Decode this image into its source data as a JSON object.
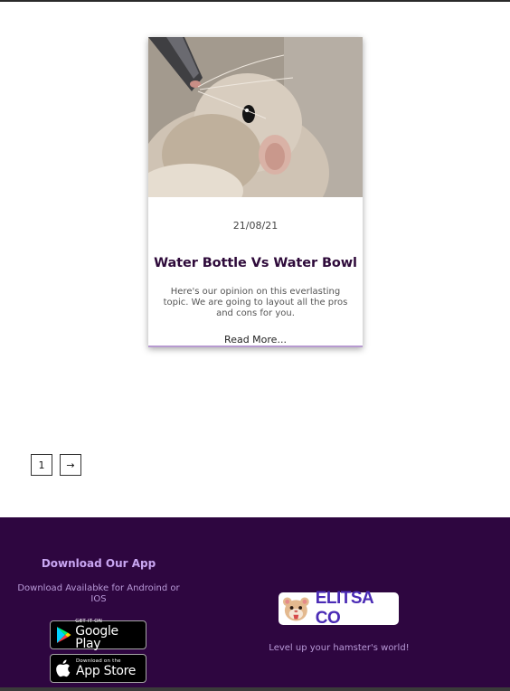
{
  "post": {
    "date": "21/08/21",
    "title": "Water Bottle Vs Water Bowl",
    "excerpt": "Here's our opinion on this everlasting topic. We are going to layout all the pros and cons for you.",
    "read_more": "Read More..."
  },
  "pagination": {
    "current": "1",
    "next": "→"
  },
  "footer": {
    "app_title": "Download Our App",
    "app_text": "Download Availabke for Androind or IOS",
    "google_play": {
      "small": "GET IT ON",
      "big": "Google Play"
    },
    "app_store": {
      "small": "Download on the",
      "big": "App Store"
    },
    "brand_name": "ELITSA CO",
    "tagline": "Level up your hamster's world!"
  },
  "colors": {
    "footer_bg": "#2e0640",
    "title": "#2e0a3a",
    "accent": "#c9a6f2",
    "brand": "#4a2bb5"
  }
}
